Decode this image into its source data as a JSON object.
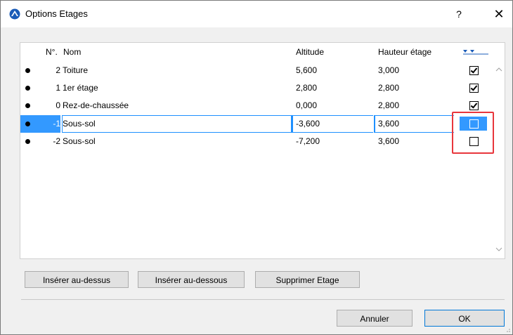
{
  "window": {
    "title": "Options Etages",
    "help_label": "?",
    "close_label": "✕"
  },
  "table": {
    "headers": {
      "num": "N°.",
      "name": "Nom",
      "altitude": "Altitude",
      "height": "Hauteur étage"
    },
    "rows": [
      {
        "num": "2",
        "name": "Toiture",
        "altitude": "5,600",
        "height": "3,000",
        "checked": true
      },
      {
        "num": "1",
        "name": "1er étage",
        "altitude": "2,800",
        "height": "2,800",
        "checked": true
      },
      {
        "num": "0",
        "name": "Rez-de-chaussée",
        "altitude": "0,000",
        "height": "2,800",
        "checked": true
      },
      {
        "num": "-1",
        "name": "Sous-sol",
        "altitude": "-3,600",
        "height": "3,600",
        "checked": false,
        "selected": true
      },
      {
        "num": "-2",
        "name": "Sous-sol",
        "altitude": "-7,200",
        "height": "3,600",
        "checked": false
      }
    ]
  },
  "buttons": {
    "insert_above": "Insérer au-dessus",
    "insert_below": "Insérer au-dessous",
    "delete": "Supprimer Etage",
    "cancel": "Annuler",
    "ok": "OK"
  },
  "colors": {
    "selection": "#3399ff",
    "highlight_frame": "#e8363c",
    "accent": "#0078d7"
  },
  "icons": [
    "app-icon",
    "close-icon",
    "filter-icon",
    "scroll-up-icon",
    "scroll-down-icon",
    "resize-grip-icon"
  ]
}
